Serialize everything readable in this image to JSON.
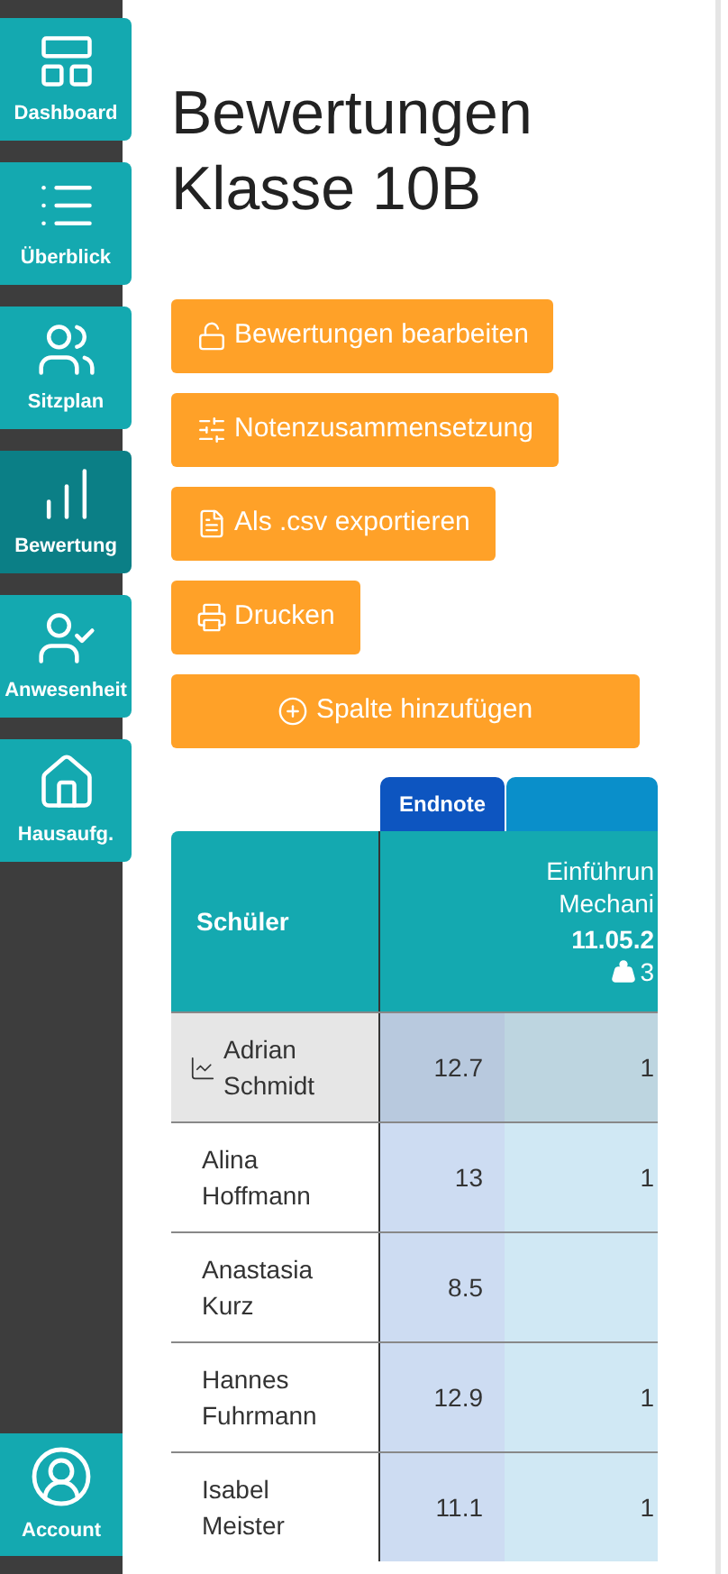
{
  "sidebar": {
    "items": [
      {
        "label": "Dashboard",
        "selected": false
      },
      {
        "label": "Überblick",
        "selected": false
      },
      {
        "label": "Sitzplan",
        "selected": false
      },
      {
        "label": "Bewertung",
        "selected": true
      },
      {
        "label": "Anwesenheit",
        "selected": false
      },
      {
        "label": "Hausaufg.",
        "selected": false
      }
    ],
    "account": {
      "label": "Account"
    }
  },
  "title": "Bewertungen Klasse 10B",
  "actions": [
    {
      "label": "Bewertungen bearbeiten"
    },
    {
      "label": "Notenzusammensetzung"
    },
    {
      "label": "Als .csv exportieren"
    },
    {
      "label": "Drucken"
    },
    {
      "label": "Spalte hinzufügen"
    }
  ],
  "table": {
    "column_tab": {
      "label": "Endnote"
    },
    "student_column": {
      "label": "Schüler"
    },
    "column_3": {
      "lines": [
        "Einführun",
        "Mechani"
      ],
      "date": "11.05.2",
      "weight": "3"
    },
    "rows": [
      {
        "name": "Adrian Schmidt",
        "trend": true,
        "selected": true,
        "values": [
          "12.7",
          "1"
        ]
      },
      {
        "name": "Alina Hoffmann",
        "trend": false,
        "selected": false,
        "values": [
          "13",
          "1"
        ]
      },
      {
        "name": "Anastasia Kurz",
        "trend": false,
        "selected": false,
        "values": [
          "8.5"
        ]
      },
      {
        "name": "Hannes Fuhrmann",
        "trend": false,
        "selected": false,
        "values": [
          "12.9",
          "1"
        ]
      },
      {
        "name": "Isabel Meister",
        "trend": false,
        "selected": false,
        "values": [
          "11.1",
          "1"
        ]
      }
    ]
  }
}
